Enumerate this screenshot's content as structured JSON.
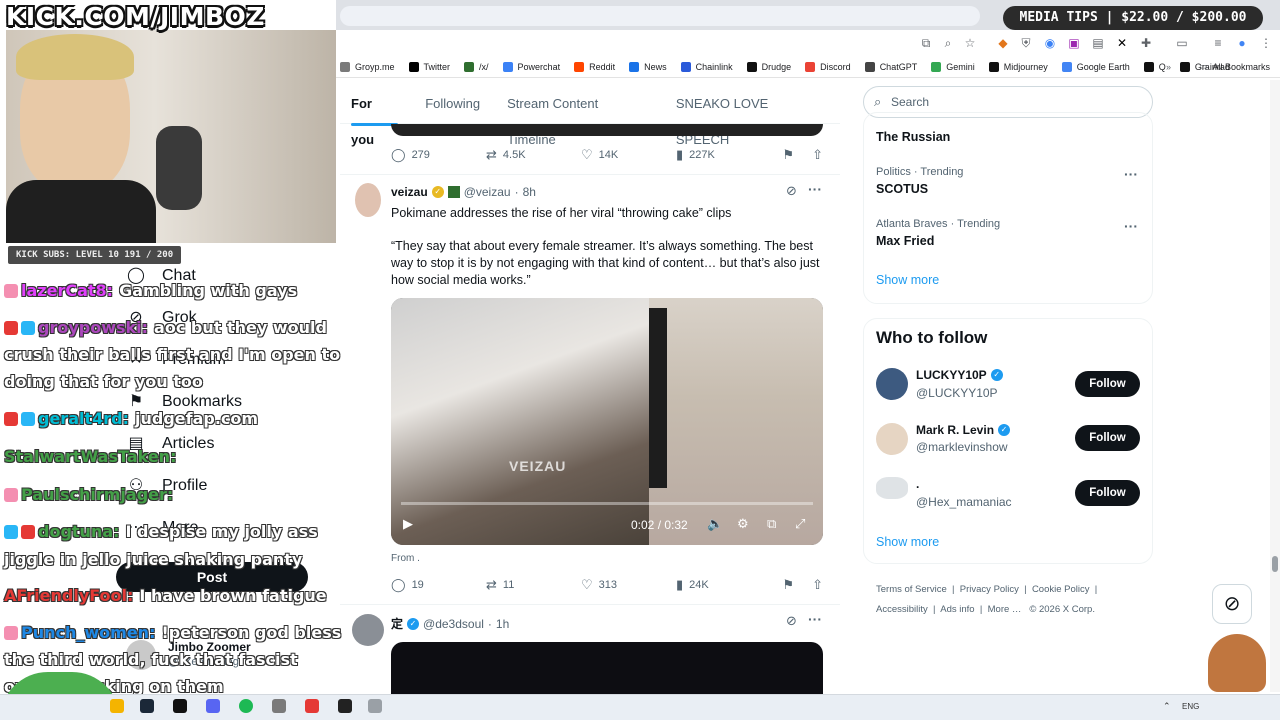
{
  "overlay": {
    "kick_url": "KICK.COM/JIMBOZ",
    "media_tips": "MEDIA TIPS | $22.00 / $200.00",
    "kick_subs": "KICK SUBS: LEVEL 10 191 / 200"
  },
  "bookmarks": [
    {
      "label": "Groyp.me",
      "color": "#7a7a7a"
    },
    {
      "label": "Twitter",
      "color": "#000000"
    },
    {
      "label": "/x/",
      "color": "#2f6e2f"
    },
    {
      "label": "Powerchat",
      "color": "#3b82f6"
    },
    {
      "label": "Reddit",
      "color": "#ff4500"
    },
    {
      "label": "News",
      "color": "#1a73e8"
    },
    {
      "label": "Chainlink",
      "color": "#2a5ada"
    },
    {
      "label": "Drudge",
      "color": "#111111"
    },
    {
      "label": "Discord",
      "color": "#ea4335"
    },
    {
      "label": "ChatGPT",
      "color": "#444444"
    },
    {
      "label": "Gemini",
      "color": "#34a853"
    },
    {
      "label": "Midjourney",
      "color": "#111111"
    },
    {
      "label": "Google Earth",
      "color": "#4285f4"
    },
    {
      "label": "Q",
      "color": "#111111"
    },
    {
      "label": "Grainrad",
      "color": "#111111"
    }
  ],
  "all_bookmarks": "All Bookmarks",
  "nav": {
    "chat": "Chat",
    "grok": "Grok",
    "premium": "Premium",
    "bookmarks": "Bookmarks",
    "articles": "Articles",
    "profile": "Profile",
    "more": "More",
    "post": "Post",
    "profile_name": "Jimbo Zoomer",
    "profile_handle": "@JZetViewing"
  },
  "chat": [
    {
      "user": "lazerCat8:",
      "color": "#e040fb",
      "text": "Gambling with gays",
      "badges": [
        "#f48fb1"
      ]
    },
    {
      "user": "groypowski:",
      "color": "#ab47bc",
      "text": "aoc but they would",
      "badges": [
        "#e53935",
        "#29b6f6"
      ]
    },
    {
      "user": "",
      "color": "#ffffff",
      "text": "crush their balls first and I'm open to",
      "badges": []
    },
    {
      "user": "",
      "color": "#ffffff",
      "text": "doing that for you too",
      "badges": []
    },
    {
      "user": "geralt4rd:",
      "color": "#00bcd4",
      "text": "judgefap.com",
      "badges": [
        "#e53935",
        "#29b6f6"
      ]
    },
    {
      "user": "StalwartWasTaken:",
      "color": "#43a047",
      "text": "",
      "badges": []
    },
    {
      "user": "Paulschirmjager:",
      "color": "#43a047",
      "text": "",
      "badges": [
        "#f48fb1"
      ]
    },
    {
      "user": "dogtuna:",
      "color": "#43a047",
      "text": "I despise my jolly ass",
      "badges": [
        "#29b6f6",
        "#e53935"
      ]
    },
    {
      "user": "",
      "color": "#ffffff",
      "text": "jiggle in jello juice shaking panty",
      "badges": []
    },
    {
      "user": "AFriendlyFool:",
      "color": "#e53935",
      "text": "I have brown fatigue",
      "badges": []
    },
    {
      "user": "Punch_women:",
      "color": "#1e88e5",
      "text": "!peterson god bless",
      "badges": [
        "#f48fb1"
      ]
    },
    {
      "user": "",
      "color": "#ffffff",
      "text": "the third world, fuck that fascist",
      "badges": []
    },
    {
      "user": "",
      "color": "#ffffff",
      "text": "own for picking on them",
      "badges": []
    }
  ],
  "tabs": [
    "For you",
    "Following",
    "Stream Content Timeline",
    "SNEAKO LOVE SPEECH"
  ],
  "tweet1_stats": {
    "replies": "279",
    "reposts": "4.5K",
    "likes": "14K",
    "views": "227K"
  },
  "tweet2": {
    "name": "veizau",
    "handle": "@veizau",
    "time": "8h",
    "line1": "Pokimane addresses the rise of her viral “throwing cake” clips",
    "quote": "“They say that about every female streamer. It’s always something. The best way to stop it is by not engaging with that kind of content… but that’s also just how social media works.”",
    "video_time": "0:02 / 0:32",
    "watermark": "VEIZAU",
    "from": "From .",
    "replies": "19",
    "reposts": "11",
    "likes": "313",
    "views": "24K"
  },
  "tweet3": {
    "name": "定",
    "handle": "@de3dsoul",
    "time": "1h"
  },
  "sidebar": {
    "search_placeholder": "Search",
    "trends": [
      {
        "category": "",
        "name": "The Russian"
      },
      {
        "category": "Politics · Trending",
        "name": "SCOTUS"
      },
      {
        "category": "Atlanta Braves · Trending",
        "name": "Max Fried"
      }
    ],
    "show_more": "Show more",
    "who_to_follow": "Who to follow",
    "follow_label": "Follow",
    "follows": [
      {
        "name": "LUCKYY10P",
        "handle": "@LUCKYY10P"
      },
      {
        "name": "Mark R. Levin",
        "handle": "@marklevinshow"
      },
      {
        "name": ".",
        "handle": "@Hex_mamaniac"
      }
    ],
    "show_more_2": "Show more",
    "footer": [
      "Terms of Service",
      "Privacy Policy",
      "Cookie Policy",
      "Accessibility",
      "Ads info",
      "More …",
      "© 2026 X Corp."
    ]
  },
  "taskbar": {
    "lang": "ENG"
  }
}
